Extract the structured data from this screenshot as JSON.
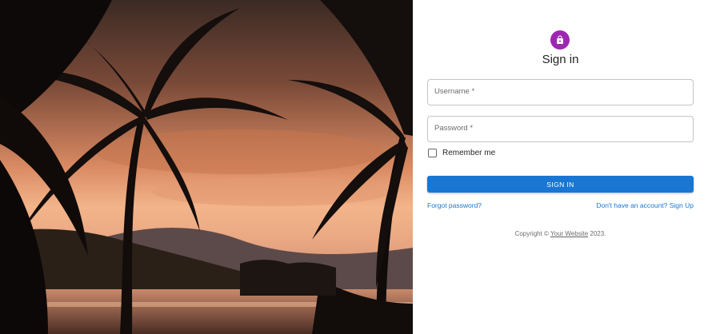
{
  "title": "Sign in",
  "avatar_icon": "lock-icon",
  "colors": {
    "avatar_bg": "#9c27b0",
    "primary": "#1976d2",
    "link": "#1976d2"
  },
  "form": {
    "username_label": "Username *",
    "password_label": "Password *",
    "username_value": "",
    "password_value": "",
    "remember_label": "Remember me",
    "remember_checked": false,
    "submit_label": "SIGN IN"
  },
  "links": {
    "forgot": "Forgot password?",
    "signup": "Don't have an account? Sign Up"
  },
  "footer": {
    "prefix": "Copyright © ",
    "link_text": "Your Website",
    "suffix": " 2023."
  }
}
